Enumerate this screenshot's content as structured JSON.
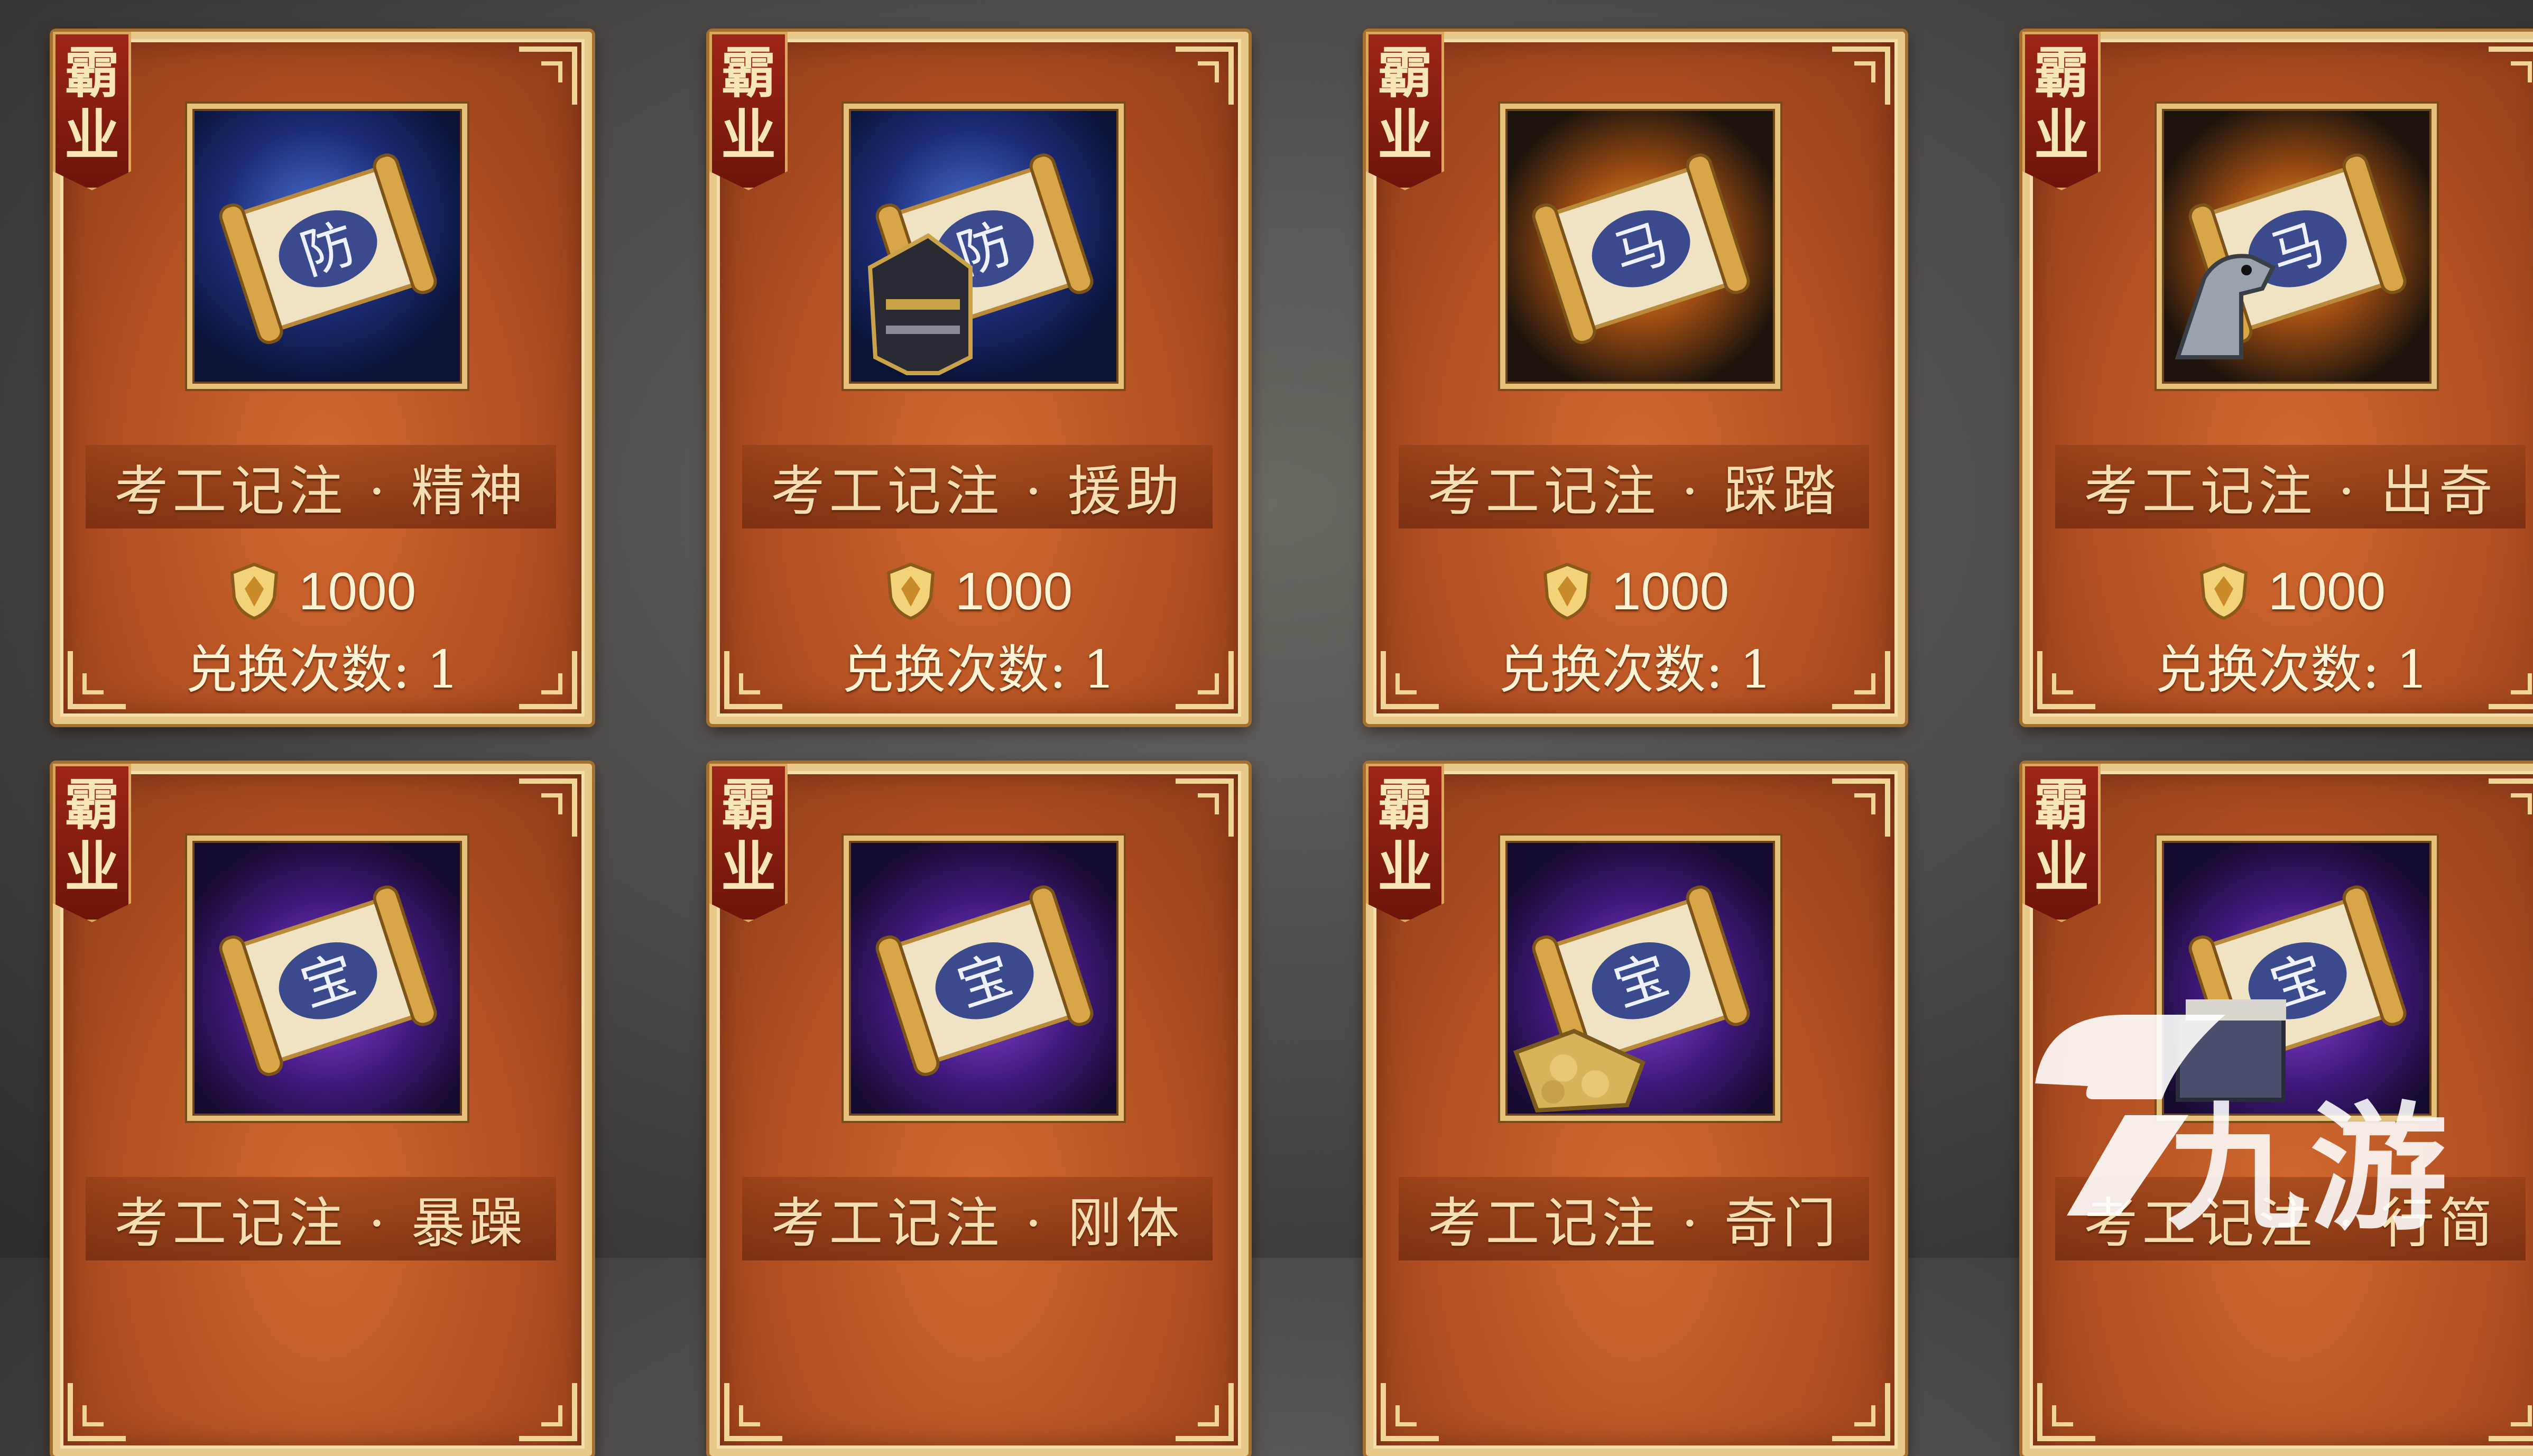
{
  "items": [
    {
      "badge": [
        "霸",
        "业"
      ],
      "name": "考工记注 · 精神",
      "price": "1000",
      "exchange": "兑换次数: 1",
      "icon": "scroll-fang-icon",
      "glyph": "防",
      "theme": "blue",
      "extra": "none"
    },
    {
      "badge": [
        "霸",
        "业"
      ],
      "name": "考工记注 · 援助",
      "price": "1000",
      "exchange": "兑换次数: 1",
      "icon": "scroll-fang-armor-icon",
      "glyph": "防",
      "theme": "blue",
      "extra": "armor"
    },
    {
      "badge": [
        "霸",
        "业"
      ],
      "name": "考工记注 · 踩踏",
      "price": "1000",
      "exchange": "兑换次数: 1",
      "icon": "scroll-ma-icon",
      "glyph": "马",
      "theme": "gold",
      "extra": "none"
    },
    {
      "badge": [
        "霸",
        "业"
      ],
      "name": "考工记注 · 出奇",
      "price": "1000",
      "exchange": "兑换次数: 1",
      "icon": "scroll-ma-horse-icon",
      "glyph": "马",
      "theme": "gold",
      "extra": "horse"
    },
    {
      "badge": [
        "霸",
        "业"
      ],
      "name": "考工记注 · 暴躁",
      "icon": "scroll-bao-icon",
      "glyph": "宝",
      "theme": "purple",
      "extra": "none"
    },
    {
      "badge": [
        "霸",
        "业"
      ],
      "name": "考工记注 · 刚体",
      "icon": "scroll-bao-icon",
      "glyph": "宝",
      "theme": "purple",
      "extra": "none"
    },
    {
      "badge": [
        "霸",
        "业"
      ],
      "name": "考工记注 · 奇门",
      "icon": "scroll-bao-coins-icon",
      "glyph": "宝",
      "theme": "purple",
      "extra": "coins"
    },
    {
      "badge": [
        "霸",
        "业"
      ],
      "name": "考工记注 · 行简",
      "icon": "scroll-bao-book-icon",
      "glyph": "宝",
      "theme": "purple",
      "extra": "book"
    }
  ],
  "currency_icon": "shield-gem-icon",
  "watermark": {
    "text": "九游",
    "icon": "jiuyou-logo-icon"
  }
}
